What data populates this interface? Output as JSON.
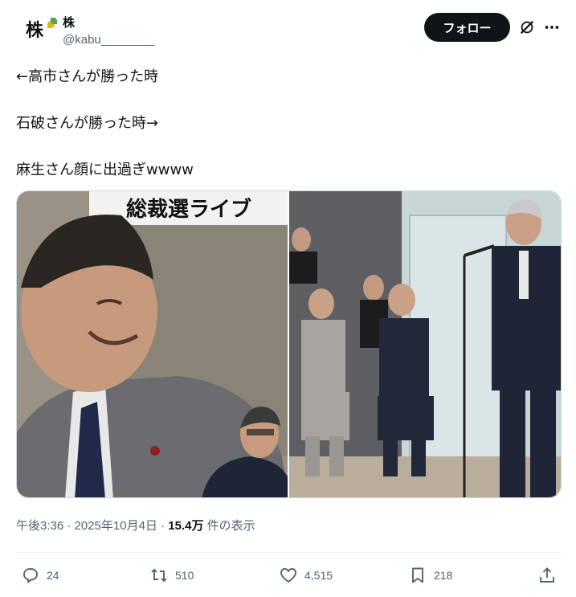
{
  "author": {
    "display_name": "株",
    "handle": "@kabu________",
    "avatar_glyph": "株"
  },
  "header": {
    "follow_label": "フォロー"
  },
  "tweet": {
    "line1": "←高市さんが勝った時",
    "line2": "石破さんが勝った時→",
    "line3": "麻生さん顔に出過ぎwwww"
  },
  "media": {
    "left_caption": "総裁選ライブ",
    "left_alt": "photo-left",
    "right_alt": "photo-right"
  },
  "meta": {
    "time_date": "午後3:36 · 2025年10月4日 · ",
    "views": "15.4万",
    "views_suffix": " 件の表示"
  },
  "actions": {
    "replies": "24",
    "reposts": "510",
    "likes": "4,515",
    "bookmarks": "218"
  },
  "icons": {
    "reply": "reply-icon",
    "repost": "repost-icon",
    "like": "heart-icon",
    "bookmark": "bookmark-icon",
    "share": "share-icon",
    "grok": "grok-icon",
    "more": "more-icon"
  },
  "colors": {
    "text": "#0f1419",
    "secondary": "#536471",
    "follow_bg": "#0f1419"
  }
}
